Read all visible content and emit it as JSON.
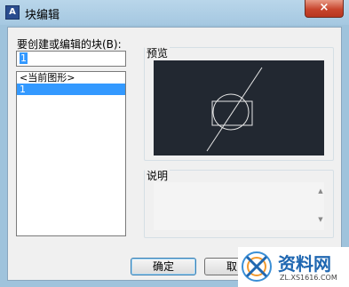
{
  "window": {
    "title": "块编辑",
    "app_icon": "cad-app-icon",
    "close_label": "×"
  },
  "form": {
    "block_label": "要创建或编辑的块(B):",
    "name_value": "1"
  },
  "block_list": {
    "items": [
      {
        "label": "<当前图形>",
        "selected": false
      },
      {
        "label": "1",
        "selected": true
      }
    ]
  },
  "preview": {
    "label": "预览"
  },
  "description": {
    "label": "说明",
    "value": ""
  },
  "buttons": {
    "ok": "确定",
    "cancel": "取"
  },
  "watermark": {
    "name": "资料网",
    "url": "ZL.XS1616.COM"
  },
  "colors": {
    "title_bar": "#a5c8e1",
    "preview_bg": "#222831",
    "selection": "#3399ff"
  }
}
